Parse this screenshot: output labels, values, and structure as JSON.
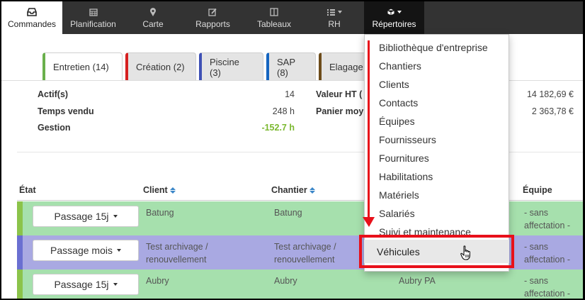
{
  "nav": {
    "items": [
      {
        "label": "Commandes",
        "icon": "inbox-icon"
      },
      {
        "label": "Planification",
        "icon": "calendar-icon"
      },
      {
        "label": "Carte",
        "icon": "map-marker-icon"
      },
      {
        "label": "Rapports",
        "icon": "edit-icon"
      },
      {
        "label": "Tableaux",
        "icon": "columns-icon"
      },
      {
        "label": "RH",
        "icon": "list-icon"
      },
      {
        "label": "Répertoires",
        "icon": "cube-icon"
      }
    ]
  },
  "tabs": [
    {
      "label": "Entretien (14)",
      "color": "#6ab04c"
    },
    {
      "label": "Création (2)",
      "color": "#d62020"
    },
    {
      "label": "Piscine (3)",
      "color": "#3f51b5"
    },
    {
      "label": "SAP (8)",
      "color": "#1565c0"
    },
    {
      "label": "Elagage",
      "color": "#6d4c1a"
    }
  ],
  "stats": {
    "actifs_label": "Actif(s)",
    "actifs_value": "14",
    "temps_label": "Temps vendu",
    "temps_value": "248 h",
    "gestion_label": "Gestion",
    "gestion_value": "-152.7 h",
    "valeur_label": "Valeur HT (",
    "valeur_value": "14 182,69 €",
    "panier_label": "Panier moy",
    "panier_value": "2 363,78 €"
  },
  "table": {
    "headers": {
      "etat": "État",
      "client": "Client",
      "chantier": "Chantier",
      "equipe": "Équipe"
    },
    "rows": [
      {
        "button": "Passage 15j",
        "client": "Batung",
        "chantier": "Batung",
        "extra": "",
        "equipe": "- sans affectation -",
        "bar": "#8bc34a",
        "bg": "#a6e0ad"
      },
      {
        "button": "Passage mois",
        "client": "Test archivage / renouvellement",
        "chantier": "Test archivage / renouvellement",
        "extra": "",
        "equipe": "- sans affectation -",
        "bar": "#6a6fd1",
        "bg": "#a9a9e2"
      },
      {
        "button": "Passage 15j",
        "client": "Aubry",
        "chantier": "Aubry",
        "extra": "Aubry PA",
        "equipe": "- sans affectation -",
        "bar": "#8bc34a",
        "bg": "#a6e0ad"
      }
    ]
  },
  "dropdown": {
    "items": [
      "Bibliothèque d'entreprise",
      "Chantiers",
      "Clients",
      "Contacts",
      "Équipes",
      "Fournisseurs",
      "Fournitures",
      "Habilitations",
      "Matériels",
      "Salariés",
      "Suivi et maintenance"
    ],
    "highlighted": "Véhicules"
  },
  "colors": {
    "annotation": "#e8101a",
    "nav_bg": "#333333"
  }
}
